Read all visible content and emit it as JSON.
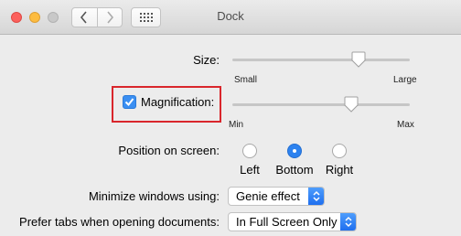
{
  "window": {
    "title": "Dock",
    "traffic_lights": [
      "close",
      "minimize",
      "zoom"
    ],
    "nav": {
      "back_icon": "chevron-left-icon",
      "forward_icon": "chevron-right-icon",
      "grid_icon": "show-all-grid-icon"
    }
  },
  "size": {
    "label": "Size:",
    "min_label": "Small",
    "max_label": "Large",
    "value_fraction": 0.71
  },
  "magnification": {
    "label": "Magnification:",
    "checked": true,
    "min_label": "Min",
    "max_label": "Max",
    "value_fraction": 0.67,
    "highlight_color": "#d9262c"
  },
  "position": {
    "label": "Position on screen:",
    "options": [
      {
        "label": "Left",
        "selected": false
      },
      {
        "label": "Bottom",
        "selected": true
      },
      {
        "label": "Right",
        "selected": false
      }
    ]
  },
  "minimize": {
    "label": "Minimize windows using:",
    "value": "Genie effect"
  },
  "tabs": {
    "label": "Prefer tabs when opening documents:",
    "value": "In Full Screen Only"
  },
  "colors": {
    "accent": "#2d82ef",
    "highlight": "#d9262c"
  }
}
